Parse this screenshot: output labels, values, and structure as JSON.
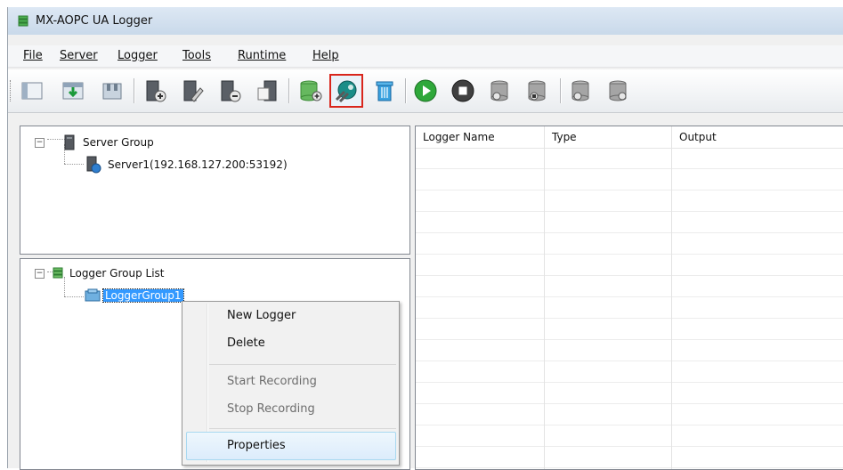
{
  "window": {
    "title": "MX-AOPC UA Logger"
  },
  "menu": [
    {
      "label": "File"
    },
    {
      "label": "Server"
    },
    {
      "label": "Logger"
    },
    {
      "label": "Tools"
    },
    {
      "label": "Runtime"
    },
    {
      "label": "Help"
    }
  ],
  "toolbar": {
    "buttons": [
      "new-icon",
      "import-icon",
      "save-icon",
      "add-server-icon",
      "edit-server-icon",
      "remove-server-icon",
      "server-properties-icon",
      "add-logger-group-icon",
      "logger-group-properties-icon",
      "delete-icon",
      "start-icon",
      "stop-icon",
      "start-recording-icon",
      "stop-recording-icon",
      "start-logger-icon",
      "stop-logger-icon"
    ],
    "highlighted": "logger-group-properties-icon",
    "highlight_color": "#d9261c"
  },
  "server_tree": {
    "root": "Server Group",
    "child": "Server1(192.168.127.200:53192)"
  },
  "logger_tree": {
    "root": "Logger Group List",
    "child": "LoggerGroup1"
  },
  "logger_table": {
    "columns": [
      "Logger Name",
      "Type",
      "Output"
    ],
    "rows": []
  },
  "context_menu": {
    "items": [
      {
        "label": "New Logger",
        "enabled": true
      },
      {
        "label": "Delete",
        "enabled": true
      },
      {
        "label": "Start Recording",
        "enabled": false
      },
      {
        "label": "Stop Recording",
        "enabled": false
      },
      {
        "label": "Properties",
        "enabled": true,
        "hovered": true
      }
    ]
  },
  "colors": {
    "selection": "#3399ff",
    "highlight": "#d9261c"
  }
}
